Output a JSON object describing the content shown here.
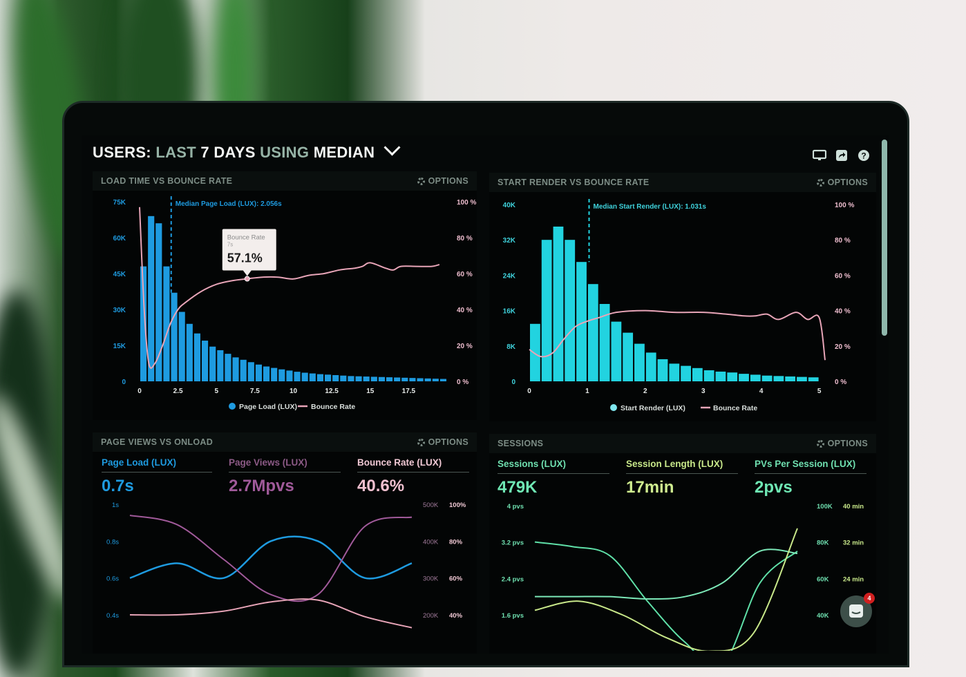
{
  "header": {
    "title_parts": [
      "USERS:",
      "LAST",
      "7 DAYS",
      "USING",
      "MEDIAN"
    ],
    "icons": [
      "monitor-icon",
      "share-icon",
      "help-icon"
    ]
  },
  "options_label": "OPTIONS",
  "panels": {
    "load_time": {
      "title": "LOAD TIME VS BOUNCE RATE",
      "median_label": "Median Page Load (LUX): 2.056s",
      "tooltip": {
        "title": "Bounce Rate",
        "sub": "7s",
        "value": "57.1%"
      },
      "legend": [
        "Page Load (LUX)",
        "Bounce Rate"
      ]
    },
    "start_render": {
      "title": "START RENDER VS BOUNCE RATE",
      "median_label": "Median Start Render (LUX): 1.031s",
      "legend": [
        "Start Render (LUX)",
        "Bounce Rate"
      ]
    },
    "page_views": {
      "title": "PAGE VIEWS VS ONLOAD",
      "stats": [
        {
          "label": "Page Load (LUX)",
          "value": "0.7s"
        },
        {
          "label": "Page Views (LUX)",
          "value": "2.7Mpvs"
        },
        {
          "label": "Bounce Rate (LUX)",
          "value": "40.6%"
        }
      ]
    },
    "sessions": {
      "title": "SESSIONS",
      "stats": [
        {
          "label": "Sessions (LUX)",
          "value": "479K"
        },
        {
          "label": "Session Length (LUX)",
          "value": "17min"
        },
        {
          "label": "PVs Per Session (LUX)",
          "value": "2pvs"
        }
      ]
    }
  },
  "chat": {
    "badge_count": "4"
  },
  "colors": {
    "blue": "#1e9be0",
    "cyan": "#22d3e0",
    "pink": "#e8a5b8",
    "purple": "#a05a9a",
    "green": "#5fe0a8",
    "lime": "#c8e88a"
  },
  "chart_data": [
    {
      "type": "bar",
      "title": "LOAD TIME VS BOUNCE RATE",
      "xlabel": "",
      "ylabel": "",
      "x_ticks": [
        "0",
        "2.5",
        "5",
        "7.5",
        "10",
        "12.5",
        "15",
        "17.5"
      ],
      "xlim": [
        0,
        20
      ],
      "y_ticks": [
        "0",
        "15K",
        "30K",
        "45K",
        "60K",
        "75K"
      ],
      "ylim": [
        0,
        75000
      ],
      "y2_ticks": [
        "0 %",
        "20 %",
        "40 %",
        "60 %",
        "80 %",
        "100 %"
      ],
      "y2lim": [
        0,
        100
      ],
      "series": [
        {
          "name": "Page Load (LUX)",
          "kind": "bar",
          "bin_width": 0.5,
          "values": [
            48000,
            69000,
            66000,
            48000,
            37000,
            29000,
            24000,
            20000,
            17000,
            14500,
            13000,
            11500,
            10000,
            9000,
            8000,
            7000,
            6200,
            5600,
            5000,
            4500,
            4000,
            3600,
            3300,
            3000,
            2800,
            2600,
            2400,
            2200,
            2100,
            2000,
            1900,
            1800,
            1700,
            1600,
            1500,
            1400,
            1300,
            1200,
            1100,
            1000
          ]
        },
        {
          "name": "Bounce Rate",
          "kind": "line",
          "x": [
            0,
            0.3,
            0.6,
            1,
            1.5,
            2,
            2.5,
            3,
            4,
            5,
            6,
            7,
            8,
            9,
            10,
            11,
            12,
            13,
            14,
            14.5,
            15,
            16,
            16.5,
            17,
            18,
            19,
            19.5
          ],
          "values": [
            97,
            40,
            10,
            10,
            20,
            32,
            40,
            44,
            50,
            54,
            56,
            57.1,
            58,
            58,
            57,
            59,
            60,
            62,
            63,
            64,
            66,
            63,
            62,
            64,
            64,
            64,
            65
          ]
        }
      ],
      "annotations": [
        {
          "type": "vline",
          "x": 2.056,
          "label": "Median Page Load (LUX): 2.056s"
        },
        {
          "type": "tooltip",
          "x": 7,
          "label": "Bounce Rate",
          "sub": "7s",
          "value": "57.1%"
        }
      ],
      "legend": "bottom"
    },
    {
      "type": "bar",
      "title": "START RENDER VS BOUNCE RATE",
      "x_ticks": [
        "0",
        "1",
        "2",
        "3",
        "4",
        "5"
      ],
      "xlim": [
        0,
        5.1
      ],
      "y_ticks": [
        "0",
        "8K",
        "16K",
        "24K",
        "32K",
        "40K"
      ],
      "ylim": [
        0,
        40000
      ],
      "y2_ticks": [
        "0 %",
        "20 %",
        "40 %",
        "60 %",
        "80 %",
        "100 %"
      ],
      "y2lim": [
        0,
        100
      ],
      "series": [
        {
          "name": "Start Render (LUX)",
          "kind": "bar",
          "bin_width": 0.2,
          "values": [
            13000,
            32000,
            35000,
            32000,
            27000,
            22000,
            17500,
            13500,
            11000,
            8500,
            6500,
            5000,
            4000,
            3500,
            3000,
            2500,
            2200,
            2000,
            1700,
            1500,
            1300,
            1200,
            1100,
            1000,
            900
          ]
        },
        {
          "name": "Bounce Rate",
          "kind": "line",
          "x": [
            0,
            0.2,
            0.4,
            0.6,
            0.8,
            1,
            1.2,
            1.5,
            2,
            2.5,
            3,
            3.4,
            3.7,
            3.9,
            4.1,
            4.3,
            4.6,
            4.8,
            5,
            5.1
          ],
          "values": [
            18,
            14,
            16,
            24,
            31,
            34,
            36,
            39,
            40,
            39,
            39,
            38,
            37,
            37,
            38,
            35,
            39,
            35,
            36,
            12
          ]
        }
      ],
      "annotations": [
        {
          "type": "vline",
          "x": 1.031,
          "label": "Median Start Render (LUX): 1.031s"
        }
      ],
      "legend": "bottom"
    },
    {
      "type": "line",
      "title": "PAGE VIEWS VS ONLOAD",
      "y_ticks": [
        "0.4s",
        "0.6s",
        "0.8s",
        "1s"
      ],
      "ylim": [
        0.4,
        1.0
      ],
      "y2_ticks": [
        "200K",
        "300K",
        "400K",
        "500K"
      ],
      "y3_ticks": [
        "40%",
        "60%",
        "80%",
        "100%"
      ],
      "series": [
        {
          "name": "Page Load (LUX)",
          "axis": "left",
          "values": [
            0.6,
            0.68,
            0.6,
            0.8,
            0.8,
            0.6,
            0.68
          ]
        },
        {
          "name": "Page Views (LUX)",
          "axis": "right",
          "values": [
            470000,
            445000,
            350000,
            255000,
            255000,
            440000,
            465000
          ]
        },
        {
          "name": "Bounce Rate (LUX)",
          "axis": "right2",
          "values": [
            40,
            40,
            42,
            47,
            48,
            39,
            33
          ]
        }
      ]
    },
    {
      "type": "line",
      "title": "SESSIONS",
      "y_ticks": [
        "1.6 pvs",
        "2.4 pvs",
        "3.2 pvs",
        "4 pvs"
      ],
      "y2_ticks": [
        "40K",
        "60K",
        "80K",
        "100K"
      ],
      "y3_ticks": [
        "24 min",
        "32 min",
        "40 min"
      ],
      "series": [
        {
          "name": "Sessions (LUX)",
          "values": [
            3.2,
            3.1,
            2.9,
            1.9,
            1.0,
            0.5,
            2.3,
            3.0
          ]
        },
        {
          "name": "Session Length (LUX)",
          "values": [
            2.0,
            2.0,
            2.0,
            1.95,
            2.0,
            2.3,
            3.0,
            2.95
          ]
        },
        {
          "name": "PVs Per Session (LUX)",
          "values": [
            1.7,
            1.9,
            1.6,
            1.1,
            0.8,
            1.2,
            3.5
          ]
        }
      ]
    }
  ]
}
